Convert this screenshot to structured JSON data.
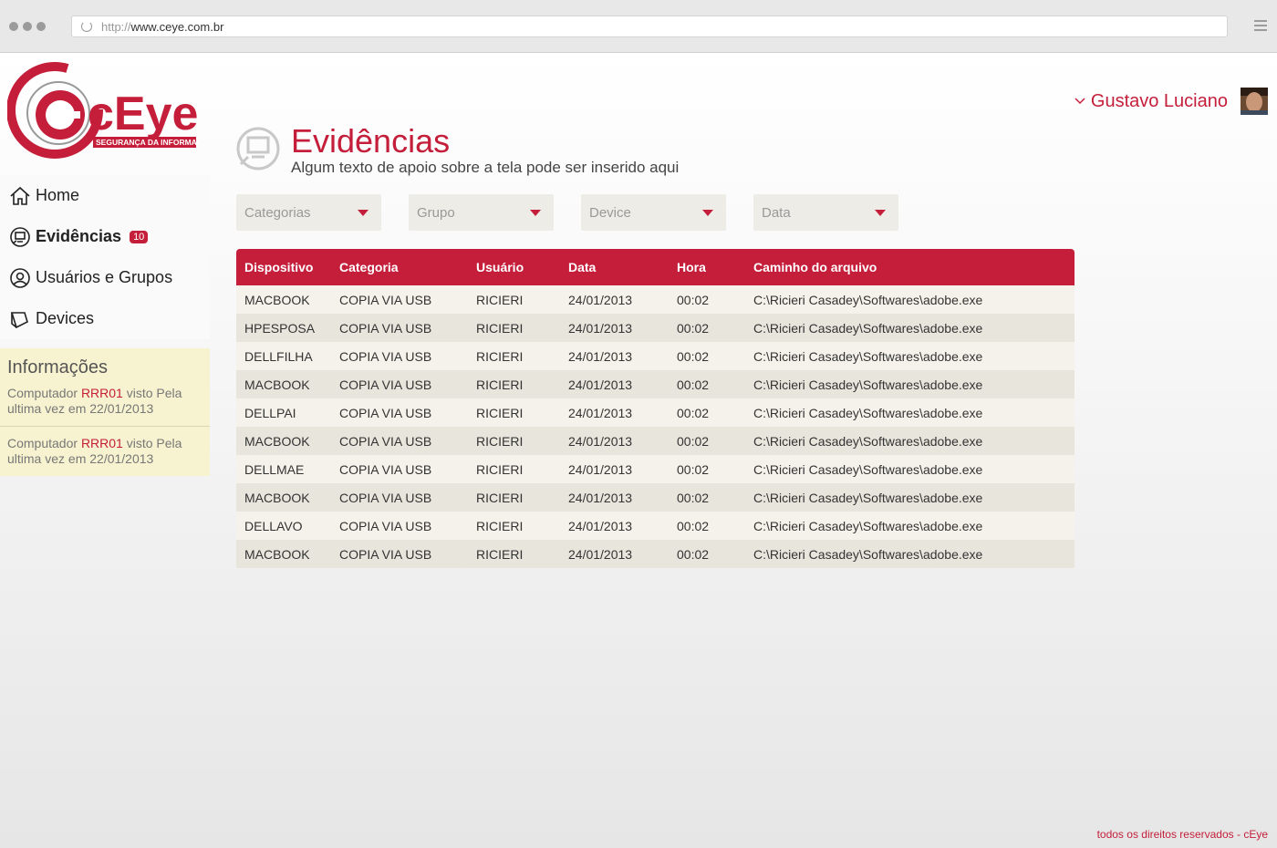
{
  "browser": {
    "url_protocol": "http://",
    "url_host": "www.ceye.com.br"
  },
  "logo": {
    "brand": "cEye",
    "tagline": "SEGURANÇA DA INFORMAÇÃO"
  },
  "user": {
    "name": "Gustavo Luciano"
  },
  "sidebar": {
    "items": [
      {
        "label": "Home",
        "icon": "home-icon"
      },
      {
        "label": "Evidências",
        "icon": "monitor-icon",
        "badge": "10"
      },
      {
        "label": "Usuários e Grupos",
        "icon": "user-icon"
      },
      {
        "label": "Devices",
        "icon": "device-icon"
      }
    ]
  },
  "info": {
    "title": "Informações",
    "items": [
      {
        "prefix": "Computador ",
        "highlight": "RRR01",
        "suffix": " visto  Pela ultima vez em 22/01/2013"
      },
      {
        "prefix": "Computador ",
        "highlight": "RRR01",
        "suffix": " visto  Pela ultima vez em 22/01/2013"
      }
    ]
  },
  "page": {
    "title": "Evidências",
    "subtitle": "Algum texto de apoio sobre a tela pode ser inserido aqui"
  },
  "filters": [
    {
      "placeholder": "Categorias"
    },
    {
      "placeholder": "Grupo"
    },
    {
      "placeholder": "Device"
    },
    {
      "placeholder": "Data"
    }
  ],
  "table": {
    "headers": [
      "Dispositivo",
      "Categoria",
      "Usuário",
      "Data",
      "Hora",
      "Caminho do arquivo"
    ],
    "rows": [
      [
        "MACBOOK",
        "COPIA VIA USB",
        "RICIERI",
        "24/01/2013",
        "00:02",
        "C:\\Ricieri Casadey\\Softwares\\adobe.exe"
      ],
      [
        "HPESPOSA",
        "COPIA VIA USB",
        "RICIERI",
        "24/01/2013",
        "00:02",
        "C:\\Ricieri Casadey\\Softwares\\adobe.exe"
      ],
      [
        "DELLFILHA",
        "COPIA VIA USB",
        "RICIERI",
        "24/01/2013",
        "00:02",
        "C:\\Ricieri Casadey\\Softwares\\adobe.exe"
      ],
      [
        "MACBOOK",
        "COPIA VIA USB",
        "RICIERI",
        "24/01/2013",
        "00:02",
        "C:\\Ricieri Casadey\\Softwares\\adobe.exe"
      ],
      [
        "DELLPAI",
        "COPIA VIA USB",
        "RICIERI",
        "24/01/2013",
        "00:02",
        "C:\\Ricieri Casadey\\Softwares\\adobe.exe"
      ],
      [
        "MACBOOK",
        "COPIA VIA USB",
        "RICIERI",
        "24/01/2013",
        "00:02",
        "C:\\Ricieri Casadey\\Softwares\\adobe.exe"
      ],
      [
        "DELLMAE",
        "COPIA VIA USB",
        "RICIERI",
        "24/01/2013",
        "00:02",
        "C:\\Ricieri Casadey\\Softwares\\adobe.exe"
      ],
      [
        "MACBOOK",
        "COPIA VIA USB",
        "RICIERI",
        "24/01/2013",
        "00:02",
        "C:\\Ricieri Casadey\\Softwares\\adobe.exe"
      ],
      [
        "DELLAVO",
        "COPIA VIA USB",
        "RICIERI",
        "24/01/2013",
        "00:02",
        "C:\\Ricieri Casadey\\Softwares\\adobe.exe"
      ],
      [
        "MACBOOK",
        "COPIA VIA USB",
        "RICIERI",
        "24/01/2013",
        "00:02",
        "C:\\Ricieri Casadey\\Softwares\\adobe.exe"
      ]
    ]
  },
  "footer": {
    "text": "todos os direitos reservados - cEye"
  },
  "colors": {
    "accent": "#c41e3a",
    "info_bg": "#f7f2cf",
    "row_odd": "#f4f2ea",
    "row_even": "#e7e5dc"
  }
}
